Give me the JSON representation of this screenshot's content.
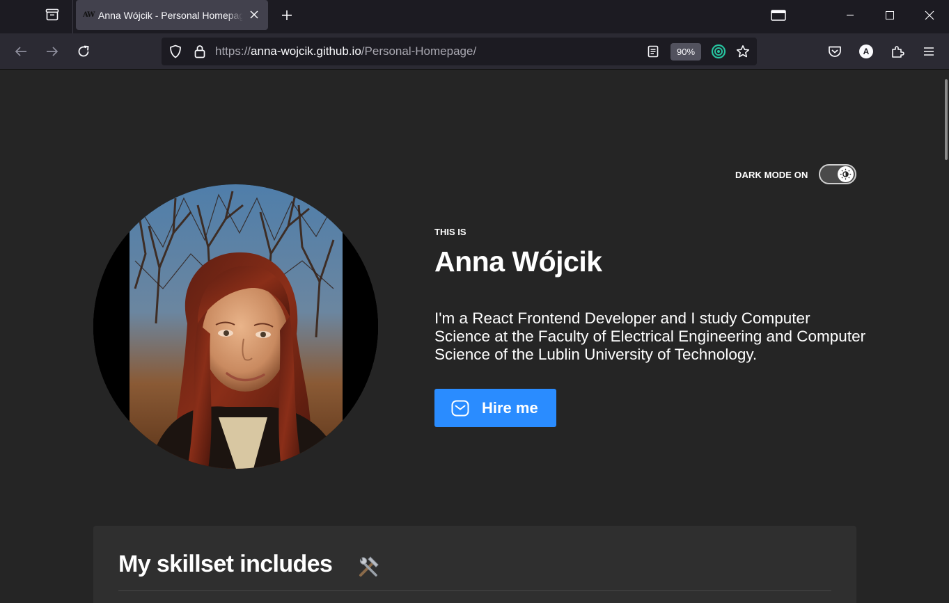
{
  "browser": {
    "tab": {
      "favicon_text": "AW",
      "title": "Anna Wójcik - Personal Homepage"
    },
    "url": {
      "scheme": "https://",
      "host": "anna-wojcik.github.io",
      "path": "/Personal-Homepage/"
    },
    "zoom": "90%",
    "account_initial": "A",
    "icons": {
      "tab_list": "tab-list-icon",
      "close_tab": "close-icon",
      "new_tab": "plus-icon",
      "pip": "picture-in-picture-icon",
      "minimize": "minimize-icon",
      "maximize": "maximize-icon",
      "close_window": "close-window-icon",
      "back": "arrow-left-icon",
      "forward": "arrow-right-icon",
      "reload": "reload-icon",
      "shield": "shield-icon",
      "lock": "lock-icon",
      "reader": "reader-view-icon",
      "extension_target": "target-extension-icon",
      "bookmark": "star-icon",
      "pocket": "pocket-icon",
      "extensions": "puzzle-icon",
      "menu": "hamburger-menu-icon"
    }
  },
  "page": {
    "theme": {
      "background": "#252525",
      "card_background": "#2f2f2f",
      "accent": "#2a8cff",
      "text": "#ffffff"
    },
    "dark_mode": {
      "label": "DARK MODE ON",
      "enabled": true,
      "icon": "brightness-icon"
    },
    "hero": {
      "photo_alt": "Anna Wójcik portrait photo",
      "pre_title": "THIS IS",
      "name": "Anna Wójcik",
      "intro": "I'm a React Frontend Developer and I study Computer Science at the Faculty of Electrical Engineering and Computer Science of the Lublin University of Technology.",
      "cta": {
        "label": "Hire me",
        "icon": "mail-icon"
      }
    },
    "skills": {
      "title": "My skillset includes",
      "icon": "hammer-and-wrench-icon"
    }
  }
}
